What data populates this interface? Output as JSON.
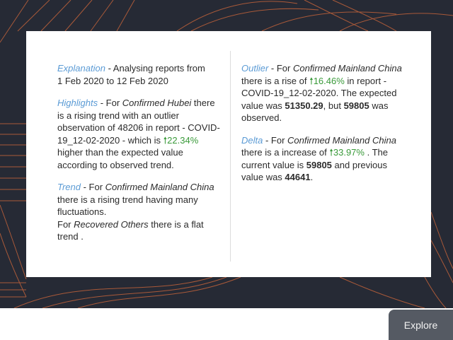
{
  "insights": {
    "explanation": {
      "label": "Explanation",
      "text_a": " - Analysing reports from",
      "text_b": "1 Feb 2020 to 12 Feb 2020"
    },
    "highlights": {
      "label": "Highlights",
      "text_a": " - For ",
      "measure": "Confirmed Hubei",
      "text_b": " there is a rising trend with an outlier observation of 48206 in report - COVID-19_12-02-2020 - which is ",
      "arrow": "🠕",
      "percent": "22.34%",
      "text_c": " higher than the expected value according to observed trend."
    },
    "trend": {
      "label": "Trend",
      "text_a": " - For ",
      "measure_1": "Confirmed Mainland China",
      "text_b": " there is a rising trend having many fluctuations.",
      "text_c": "For ",
      "measure_2": "Recovered Others",
      "text_d": " there is a flat trend ."
    },
    "outlier": {
      "label": "Outlier",
      "text_a": " - For ",
      "measure": "Confirmed Mainland China",
      "text_b": " there is a rise of ",
      "arrow": "🠕",
      "percent": "16.46%",
      "text_c": " in report - COVID-19_12-02-2020. The expected value was ",
      "expected": "51350.29",
      "text_d": ", but ",
      "observed": "59805",
      "text_e": " was observed."
    },
    "delta": {
      "label": "Delta",
      "text_a": " - For ",
      "measure": "Confirmed Mainland China",
      "text_b": " there is a increase of ",
      "arrow": "🠕",
      "percent": "33.97%",
      "text_c": " . The current value is ",
      "current": "59805",
      "text_d": " and previous value was ",
      "previous": "44641",
      "text_e": "."
    }
  },
  "explore_button": {
    "label": "Explore"
  },
  "colors": {
    "background_dark": "#262a35",
    "accent_lines": "#c0623a",
    "keyword_blue": "#5b9bd5",
    "positive_green": "#3a9a3a",
    "button_bg": "#555a63"
  }
}
